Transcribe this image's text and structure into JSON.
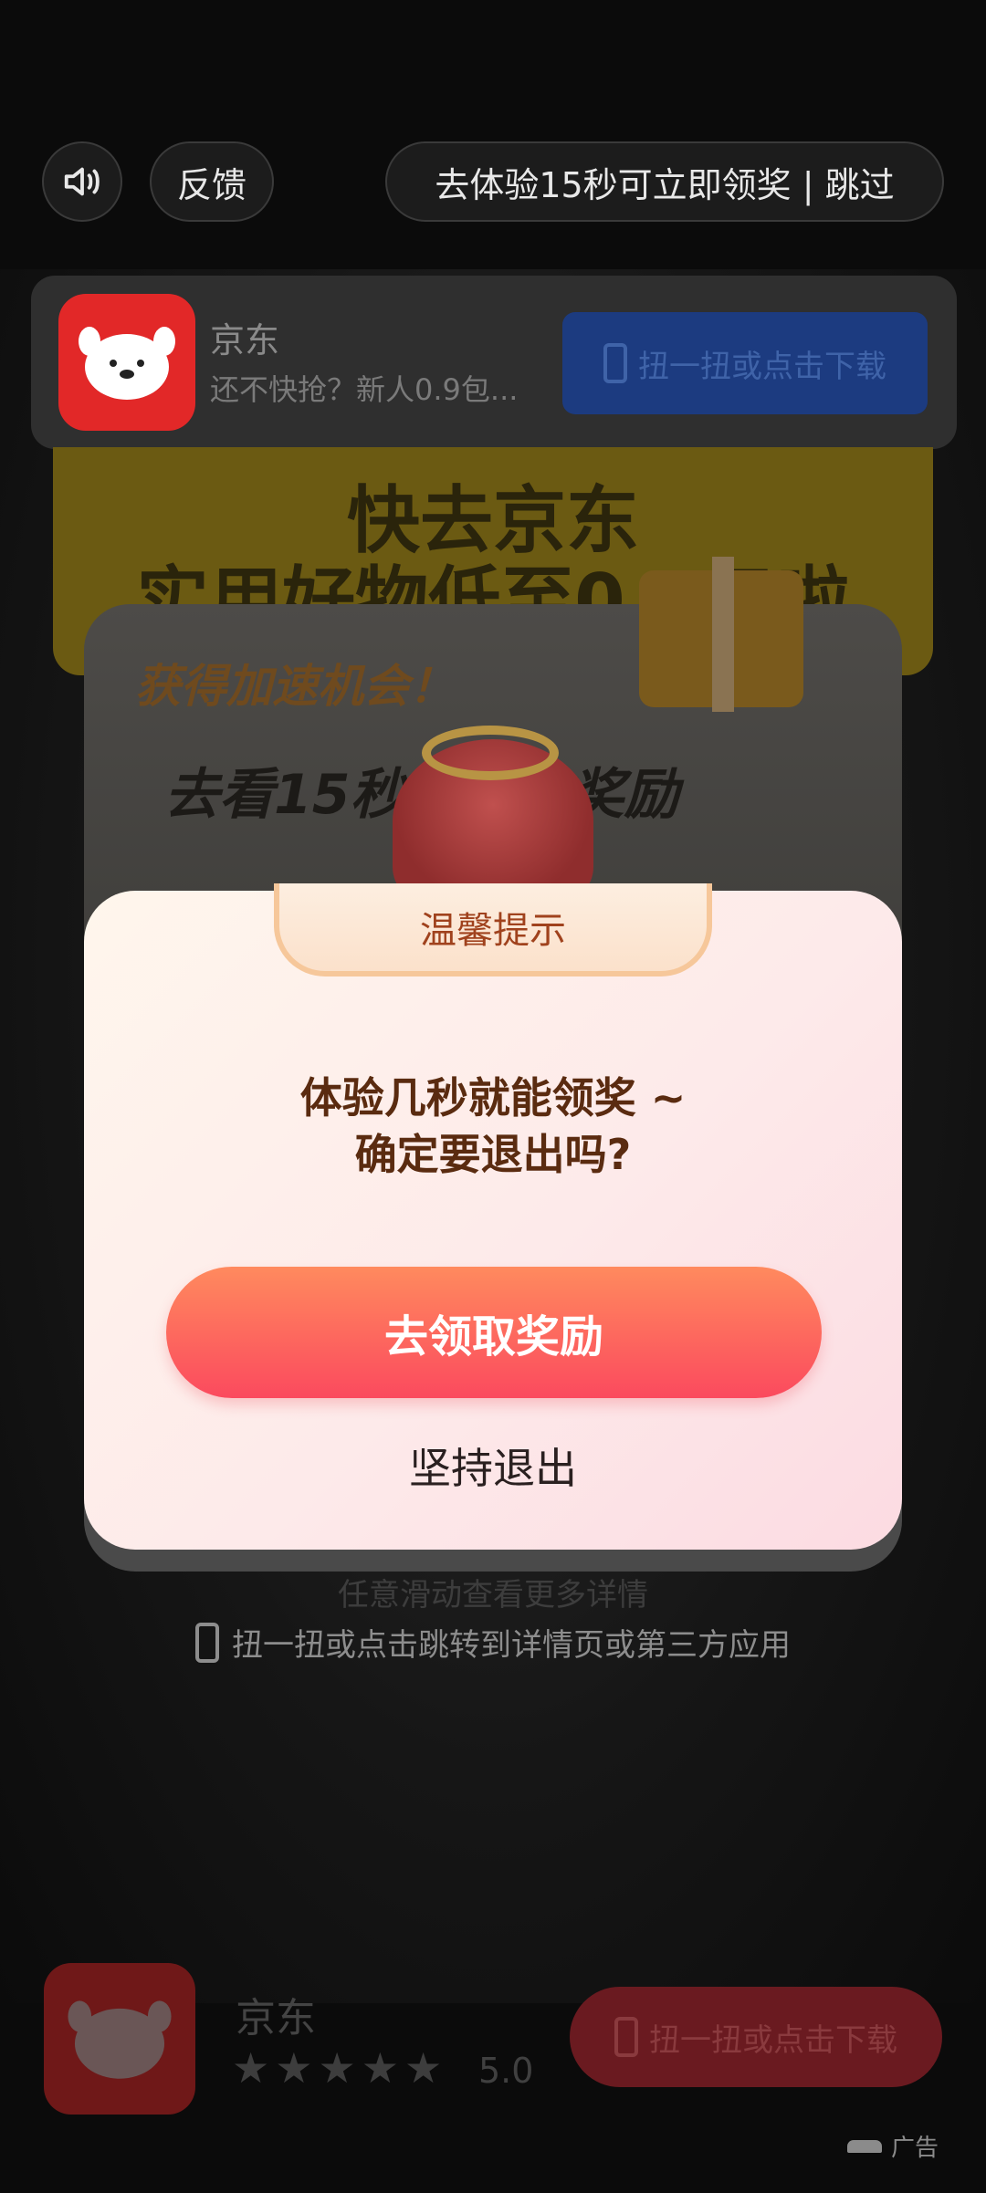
{
  "top_bar": {
    "feedback_label": "反馈",
    "skip_label": "去体验15秒可立即领奖 | 跳过"
  },
  "app_card": {
    "name": "京东",
    "description": "还不快抢？新人0.9包...",
    "download_label": "扭一扭或点击下载"
  },
  "banner": {
    "line1": "快去京东",
    "line2": "实用好物低至0.9元啦"
  },
  "bonus": {
    "title": "获得加速机会！",
    "subtitle": "去看15秒直接拿奖励"
  },
  "background_hint": {
    "ghost_text": "任意滑动查看更多详情",
    "text": "扭一扭或点击跳转到详情页或第三方应用"
  },
  "bottom_bar": {
    "name": "京东",
    "stars": 5,
    "rating": "5.0",
    "download_label": "扭一扭或点击下载"
  },
  "ad_tag": "广告",
  "dialog": {
    "header": "温馨提示",
    "message_line1": "体验几秒就能领奖 ~",
    "message_line2": "确定要退出吗?",
    "primary_label": "去领取奖励",
    "secondary_label": "坚持退出"
  },
  "colors": {
    "primary_button": "#fb4a5e",
    "dialog_header_text": "#a0421d",
    "download_button": "#1c3b80"
  },
  "icons": {
    "sound": "speaker-icon",
    "phone": "phone-icon",
    "app_logo": "jd-dog-logo",
    "star": "star-icon"
  }
}
